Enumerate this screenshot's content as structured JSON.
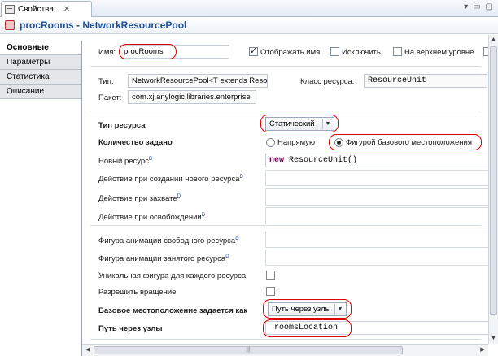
{
  "tab": {
    "title": "Свойства",
    "close": "✕"
  },
  "window_buttons": {
    "minimize": "▭",
    "maximize": "▢",
    "menu": "▾"
  },
  "header": {
    "title": "procRooms - NetworkResourcePool"
  },
  "sidebar": {
    "items": [
      {
        "label": "Основные",
        "active": true
      },
      {
        "label": "Параметры",
        "active": false
      },
      {
        "label": "Статистика",
        "active": false
      },
      {
        "label": "Описание",
        "active": false
      }
    ]
  },
  "form": {
    "name_label": "Имя:",
    "name_value": "procRooms",
    "show_name_label": "Отображать имя",
    "show_name_checked": true,
    "exclude_label": "Исключить",
    "exclude_checked": false,
    "top_level_label": "На верхнем уровне",
    "top_level_checked": false,
    "type_label": "Тип:",
    "type_value": "NetworkResourcePool<T extends Reso",
    "resource_class_label": "Класс ресурса:",
    "resource_class_value": "ResourceUnit",
    "package_label": "Пакет:",
    "package_value": "com.xj.anylogic.libraries.enterprise",
    "resource_type_label": "Тип ресурса",
    "resource_type_value": "Статический",
    "quantity_label": "Количество задано",
    "radio_direct_label": "Напрямую",
    "radio_direct_checked": false,
    "radio_home_label": "Фигурой базового местоположения",
    "radio_home_checked": true,
    "new_resource_label": "Новый ресурс",
    "new_resource_kw": "new",
    "new_resource_value": " ResourceUnit()",
    "on_create_label": "Действие при создании нового ресурса",
    "on_seize_label": "Действие при захвате",
    "on_release_label": "Действие при освобождении",
    "idle_shape_label": "Фигура анимации свободного ресурса",
    "busy_shape_label": "Фигура анимации занятого ресурса",
    "unique_shape_label": "Уникальная фигура для каждого ресурса",
    "unique_shape_checked": false,
    "allow_rotation_label": "Разрешить вращение",
    "allow_rotation_checked": false,
    "home_location_label": "Базовое местоположение задается как",
    "home_location_value": "Путь через узлы",
    "node_path_label": "Путь через узлы",
    "node_path_value": "roomsLocation",
    "dynamic_marker": "D"
  },
  "scrollbars": {
    "up": "▲",
    "down": "▼",
    "left": "◀",
    "right": "▶",
    "grip": "|||"
  },
  "annotation_color": "#e00000"
}
